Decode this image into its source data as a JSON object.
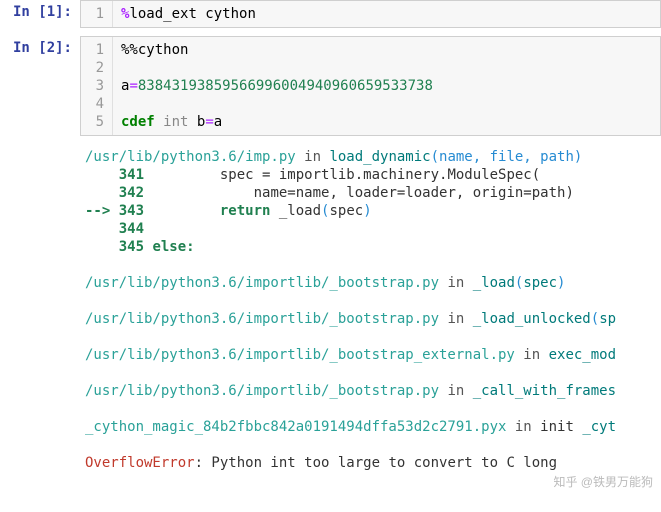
{
  "cells": [
    {
      "prompt": "In [1]:",
      "gutter": [
        "1"
      ],
      "code_html": "<span class='o-mag'>%</span>load_ext cython"
    },
    {
      "prompt": "In [2]:",
      "gutter": [
        "1",
        "2",
        "3",
        "4",
        "5"
      ],
      "code_html": "%%cython\n\na<span class='o-op'>=</span><span class='o-num'>83843193859566996004940960659533738</span>\n\n<span class='o-kw'>cdef</span> <span class='o-type'>int</span> b<span class='o-op'>=</span>a"
    }
  ],
  "traceback": [
    {
      "html": "<span class='tb-cyan'>/usr/lib/python3.6/imp.py</span><span class='tb-gray'> in </span><span class='tb-teal'>load_dynamic</span><span class='tb-blue'>(name, file, path)</span>"
    },
    {
      "html": "    <span class='tb-green'>341</span>         spec = importlib.machinery.ModuleSpec("
    },
    {
      "html": "    <span class='tb-green'>342</span>             name=name, loader=loader, origin=path)"
    },
    {
      "html": "<span class='tb-green'>--&gt; 343</span>         <span class='tb-green'>return</span> _load<span class='tb-blue'>(</span>spec<span class='tb-blue'>)</span>"
    },
    {
      "html": "    <span class='tb-green'>344</span>"
    },
    {
      "html": "    <span class='tb-green'>345</span> <span class='tb-green'>else:</span>"
    },
    {
      "html": ""
    },
    {
      "html": "<span class='tb-cyan'>/usr/lib/python3.6/importlib/_bootstrap.py</span><span class='tb-gray'> in </span><span class='tb-teal'>_load</span><span class='tb-blue'>(</span><span class='tb-teal'>spec</span><span class='tb-blue'>)</span>"
    },
    {
      "html": ""
    },
    {
      "html": "<span class='tb-cyan'>/usr/lib/python3.6/importlib/_bootstrap.py</span><span class='tb-gray'> in </span><span class='tb-teal'>_load_unlocked</span><span class='tb-blue'>(</span><span class='tb-teal'>sp</span>"
    },
    {
      "html": ""
    },
    {
      "html": "<span class='tb-cyan'>/usr/lib/python3.6/importlib/_bootstrap_external.py</span><span class='tb-gray'> in </span><span class='tb-teal'>exec_mod</span>"
    },
    {
      "html": ""
    },
    {
      "html": "<span class='tb-cyan'>/usr/lib/python3.6/importlib/_bootstrap.py</span><span class='tb-gray'> in </span><span class='tb-teal'>_call_with_frames</span>"
    },
    {
      "html": ""
    },
    {
      "html": "<span class='tb-cyan'>_cython_magic_84b2fbbc842a0191494dffa53d2c2791.pyx</span><span class='tb-gray'> in </span>init <span class='tb-teal'>_cyt</span>"
    },
    {
      "html": ""
    },
    {
      "html": "<span class='tb-red'>OverflowError</span>: Python int too large to convert to C long"
    }
  ],
  "watermark": "知乎 @铁男万能狗"
}
